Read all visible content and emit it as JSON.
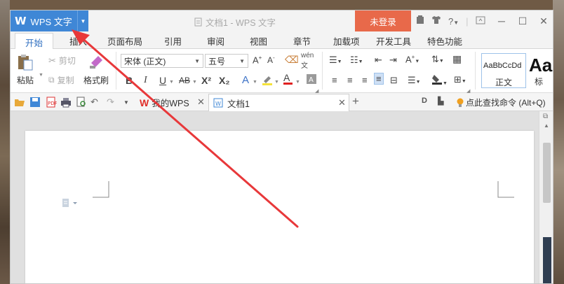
{
  "titlebar": {
    "app_name": "WPS 文字",
    "doc_title": "文档1 - WPS 文字",
    "login": "未登录",
    "help": "?"
  },
  "menu": {
    "tabs": [
      "开始",
      "插入",
      "页面布局",
      "引用",
      "审阅",
      "视图",
      "章节",
      "加载项",
      "开发工具",
      "特色功能"
    ],
    "active": "开始"
  },
  "ribbon": {
    "paste": "粘贴",
    "cut": "剪切",
    "copy": "复制",
    "format_painter": "格式刷",
    "font_name": "宋体 (正文)",
    "font_size": "五号",
    "bold": "B",
    "italic": "I",
    "underline": "U",
    "strikethrough": "AB",
    "superscript": "X²",
    "subscript": "X₂",
    "font_color_letter": "A",
    "pinyin": "wén",
    "style_sample": "AaBbCcDd",
    "style_normal": "正文",
    "style_sample2": "Aa",
    "style_heading": "标"
  },
  "quickbar": {
    "tab_wps": "我的WPS",
    "tab_doc": "文档1",
    "find_command": "点此查找命令 (Alt+Q)"
  },
  "colors": {
    "accent": "#3f87d6",
    "login": "#e8694a",
    "arrow": "#e8383a"
  }
}
